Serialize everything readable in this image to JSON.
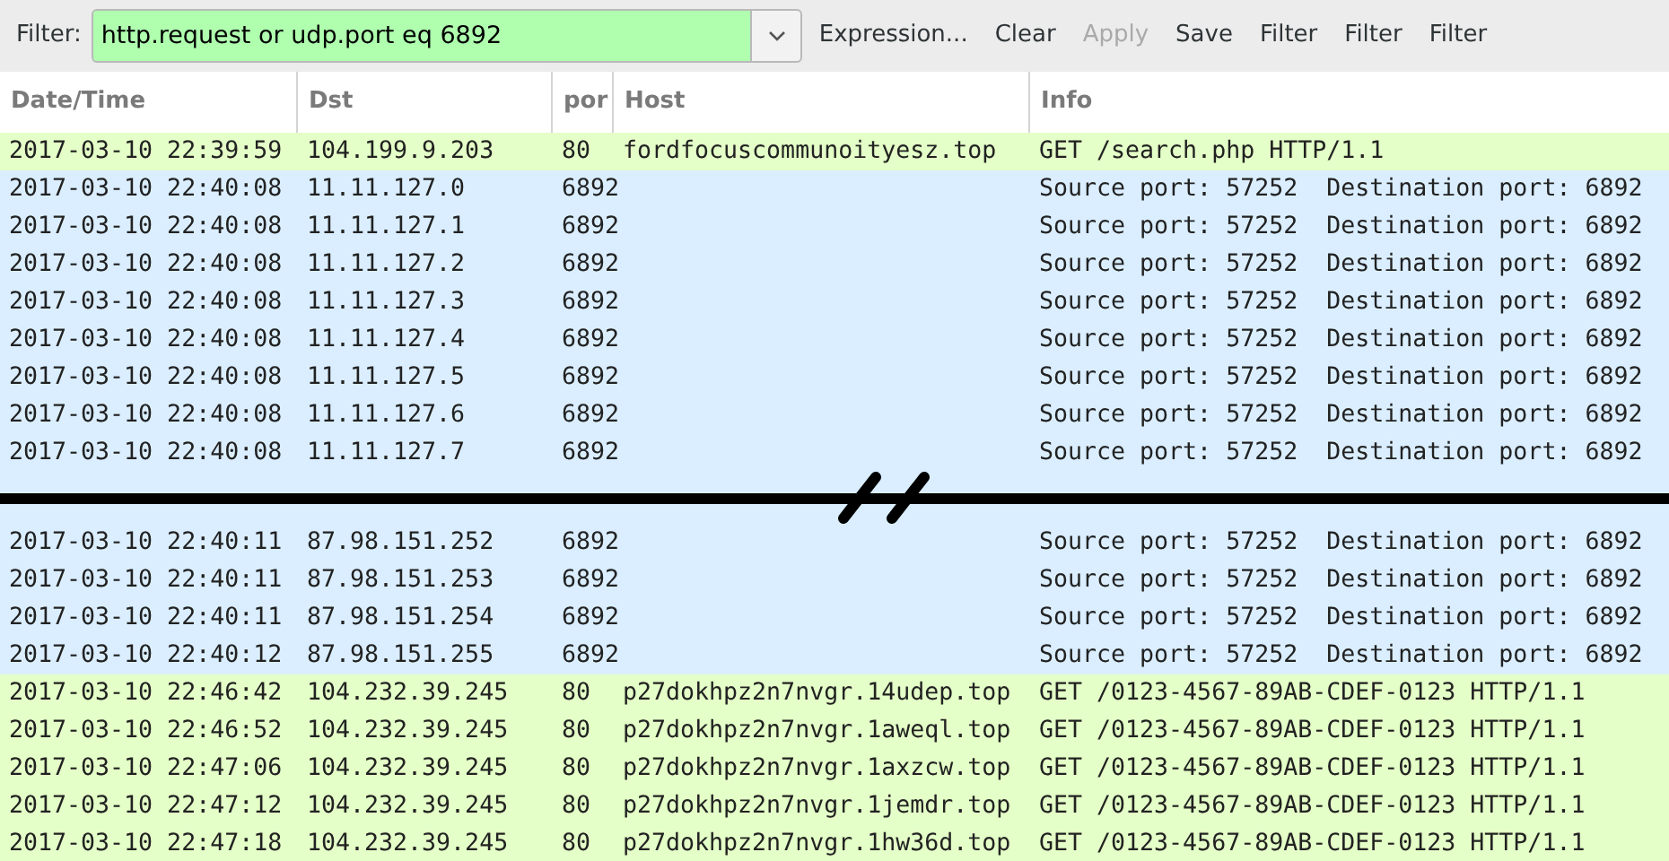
{
  "filter_bar": {
    "label": "Filter:",
    "value": "http.request or udp.port eq 6892",
    "buttons": [
      {
        "label": "Expression...",
        "disabled": false
      },
      {
        "label": "Clear",
        "disabled": false
      },
      {
        "label": "Apply",
        "disabled": true
      },
      {
        "label": "Save",
        "disabled": false
      },
      {
        "label": "Filter",
        "disabled": false
      },
      {
        "label": "Filter",
        "disabled": false
      },
      {
        "label": "Filter",
        "disabled": false
      }
    ]
  },
  "table": {
    "columns": [
      "Date/Time",
      "Dst",
      "por",
      "Host",
      "Info"
    ],
    "rows": [
      {
        "color": "#e4ffc7",
        "date_time": "2017-03-10 22:39:59",
        "dst": "104.199.9.203",
        "port": "80",
        "host": "fordfocuscommunoityesz.top",
        "info": "GET /search.php HTTP/1.1"
      },
      {
        "color": "#daeeff",
        "date_time": "2017-03-10 22:40:08",
        "dst": "11.11.127.0",
        "port": "6892",
        "info": "Source port: 57252  Destination port: 6892"
      },
      {
        "color": "#daeeff",
        "date_time": "2017-03-10 22:40:08",
        "dst": "11.11.127.1",
        "port": "6892",
        "info": "Source port: 57252  Destination port: 6892"
      },
      {
        "color": "#daeeff",
        "date_time": "2017-03-10 22:40:08",
        "dst": "11.11.127.2",
        "port": "6892",
        "info": "Source port: 57252  Destination port: 6892"
      },
      {
        "color": "#daeeff",
        "date_time": "2017-03-10 22:40:08",
        "dst": "11.11.127.3",
        "port": "6892",
        "info": "Source port: 57252  Destination port: 6892"
      },
      {
        "color": "#daeeff",
        "date_time": "2017-03-10 22:40:08",
        "dst": "11.11.127.4",
        "port": "6892",
        "info": "Source port: 57252  Destination port: 6892"
      },
      {
        "color": "#daeeff",
        "date_time": "2017-03-10 22:40:08",
        "dst": "11.11.127.5",
        "port": "6892",
        "info": "Source port: 57252  Destination port: 6892"
      },
      {
        "color": "#daeeff",
        "date_time": "2017-03-10 22:40:08",
        "dst": "11.11.127.6",
        "port": "6892",
        "info": "Source port: 57252  Destination port: 6892"
      },
      {
        "color": "#daeeff",
        "date_time": "2017-03-10 22:40:08",
        "dst": "11.11.127.7",
        "port": "6892",
        "info": "Source port: 57252  Destination port: 6892"
      },
      {
        "kind": "break",
        "color": "#daeeff"
      },
      {
        "color": "#daeeff",
        "date_time": "2017-03-10 22:40:11",
        "dst": "87.98.151.252",
        "port": "6892",
        "info": "Source port: 57252  Destination port: 6892"
      },
      {
        "color": "#daeeff",
        "date_time": "2017-03-10 22:40:11",
        "dst": "87.98.151.253",
        "port": "6892",
        "info": "Source port: 57252  Destination port: 6892"
      },
      {
        "color": "#daeeff",
        "date_time": "2017-03-10 22:40:11",
        "dst": "87.98.151.254",
        "port": "6892",
        "info": "Source port: 57252  Destination port: 6892"
      },
      {
        "color": "#daeeff",
        "date_time": "2017-03-10 22:40:12",
        "dst": "87.98.151.255",
        "port": "6892",
        "info": "Source port: 57252  Destination port: 6892"
      },
      {
        "color": "#e4ffc7",
        "date_time": "2017-03-10 22:46:42",
        "dst": "104.232.39.245",
        "port": "80",
        "host": "p27dokhpz2n7nvgr.14udep.top",
        "info": "GET /0123-4567-89AB-CDEF-0123 HTTP/1.1"
      },
      {
        "color": "#e4ffc7",
        "date_time": "2017-03-10 22:46:52",
        "dst": "104.232.39.245",
        "port": "80",
        "host": "p27dokhpz2n7nvgr.1aweql.top",
        "info": "GET /0123-4567-89AB-CDEF-0123 HTTP/1.1"
      },
      {
        "color": "#e4ffc7",
        "date_time": "2017-03-10 22:47:06",
        "dst": "104.232.39.245",
        "port": "80",
        "host": "p27dokhpz2n7nvgr.1axzcw.top",
        "info": "GET /0123-4567-89AB-CDEF-0123 HTTP/1.1"
      },
      {
        "color": "#e4ffc7",
        "date_time": "2017-03-10 22:47:12",
        "dst": "104.232.39.245",
        "port": "80",
        "host": "p27dokhpz2n7nvgr.1jemdr.top",
        "info": "GET /0123-4567-89AB-CDEF-0123 HTTP/1.1"
      },
      {
        "color": "#e4ffc7",
        "date_time": "2017-03-10 22:47:18",
        "dst": "104.232.39.245",
        "port": "80",
        "host": "p27dokhpz2n7nvgr.1hw36d.top",
        "info": "GET /0123-4567-89AB-CDEF-0123 HTTP/1.1"
      }
    ]
  }
}
